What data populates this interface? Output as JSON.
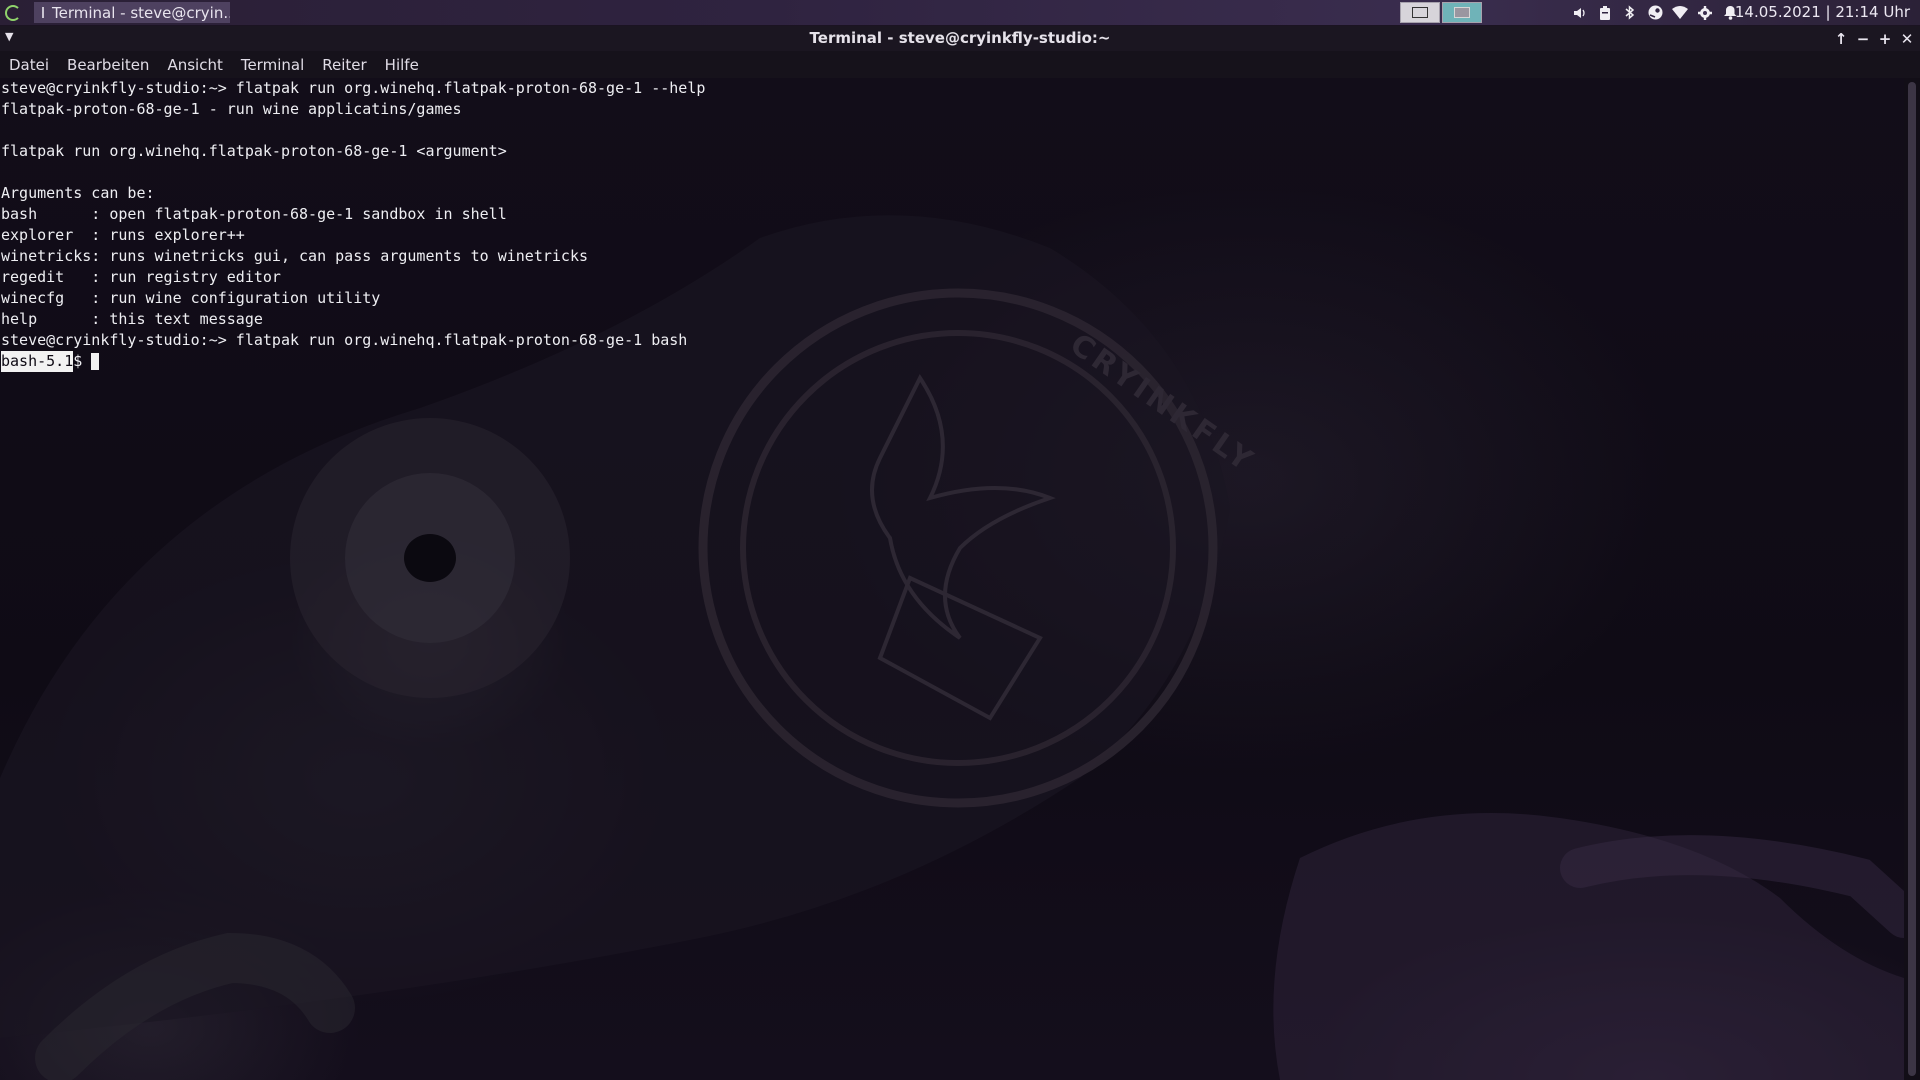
{
  "panel": {
    "task_label": "Terminal - steve@cryin...",
    "clock": "14.05.2021 | 21:14 Uhr",
    "tray_icons": [
      "volume-icon",
      "clipboard-icon",
      "bluetooth-icon",
      "steam-icon",
      "wifi-icon",
      "settings-icon",
      "notification-bell-icon"
    ]
  },
  "window": {
    "title": "Terminal - steve@cryinkfly-studio:~"
  },
  "menu": {
    "items": [
      "Datei",
      "Bearbeiten",
      "Ansicht",
      "Terminal",
      "Reiter",
      "Hilfe"
    ]
  },
  "terminal": {
    "lines": [
      "steve@cryinkfly-studio:~> flatpak run org.winehq.flatpak-proton-68-ge-1 --help",
      "flatpak-proton-68-ge-1 - run wine applicatins/games",
      "",
      "flatpak run org.winehq.flatpak-proton-68-ge-1 <argument>",
      "",
      "Arguments can be:",
      "bash      : open flatpak-proton-68-ge-1 sandbox in shell",
      "explorer  : runs explorer++",
      "winetricks: runs winetricks gui, can pass arguments to winetricks",
      "regedit   : run registry editor",
      "winecfg   : run wine configuration utility",
      "help      : this text message",
      "steve@cryinkfly-studio:~> flatpak run org.winehq.flatpak-proton-68-ge-1 bash"
    ],
    "prompt_selected": "bash-5.1",
    "prompt_rest": "$"
  },
  "wallpaper": {
    "watermark_text": "CRYINKFLY"
  },
  "colors": {
    "terminal_bg": "#0d0913",
    "text": "#eeeef2"
  }
}
